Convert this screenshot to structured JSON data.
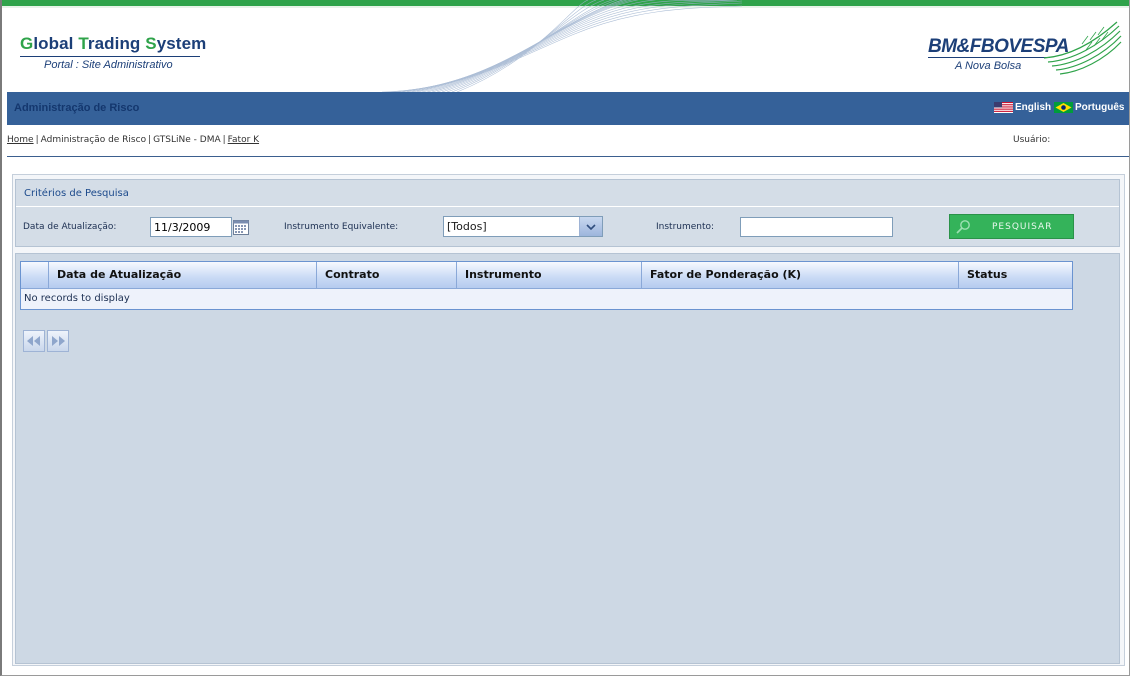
{
  "header": {
    "title_parts": [
      {
        "letter": "G",
        "rest": "lobal "
      },
      {
        "letter": "T",
        "rest": "rading "
      },
      {
        "letter": "S",
        "rest": "ystem"
      }
    ],
    "subtitle": "Portal :  Site Administrativo",
    "brand_name": "BM&FBOVESPA",
    "brand_tagline": "A Nova Bolsa"
  },
  "bluebar": {
    "title": "Administração de Risco",
    "languages": [
      {
        "label": "English",
        "flag": "us-flag-icon"
      },
      {
        "label": "Português",
        "flag": "brazil-flag-icon"
      }
    ]
  },
  "breadcrumb": {
    "items": [
      "Home",
      "Administração de Risco",
      "GTSLiNe - DMA",
      "Fator K"
    ],
    "separator": "|"
  },
  "user": {
    "label": "Usuário:"
  },
  "search": {
    "title": "Critérios de Pesquisa",
    "date_label": "Data de Atualização:",
    "date_value": "11/3/2009",
    "instrumento_equivalente_label": "Instrumento Equivalente:",
    "instrumento_equivalente_value": "[Todos]",
    "instrumento_label": "Instrumento:",
    "instrumento_value": "",
    "button_label": "PESQUISAR"
  },
  "grid": {
    "columns": [
      "",
      "Data de Atualização",
      "Contrato",
      "Instrumento",
      "Fator de Ponderação (K)",
      "Status"
    ],
    "empty_message": "No records to display"
  },
  "colors": {
    "brand_blue": "#1c3f78",
    "brand_green": "#2fa34a",
    "bar_blue": "#356199",
    "button_green": "#34b35a"
  }
}
